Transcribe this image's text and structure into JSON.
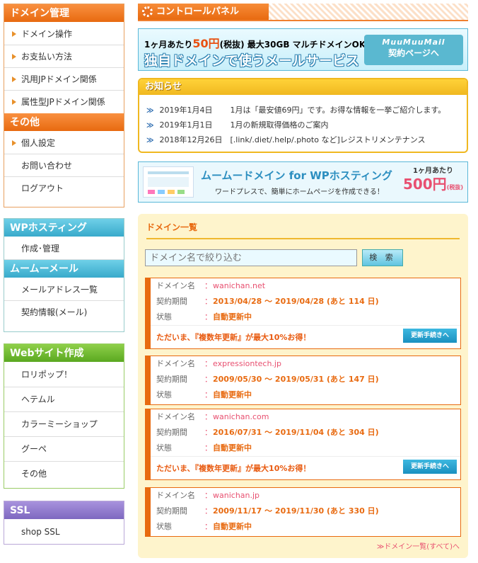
{
  "sidebar": {
    "domain": {
      "title": "ドメイン管理",
      "items": [
        "ドメイン操作",
        "お支払い方法",
        "汎用JPドメイン関係",
        "属性型JPドメイン関係"
      ]
    },
    "other": {
      "title": "その他",
      "items": [
        "個人設定",
        "お問い合わせ",
        "ログアウト"
      ]
    },
    "wp": {
      "title": "WPホスティング",
      "items": [
        "作成･管理"
      ]
    },
    "mail": {
      "title": "ムームーメール",
      "items": [
        "メールアドレス一覧",
        "契約情報(メール)"
      ]
    },
    "web": {
      "title": "Webサイト作成",
      "items": [
        "ロリポップ！",
        "ヘテムル",
        "カラーミーショップ",
        "グーペ",
        "その他"
      ]
    },
    "ssl": {
      "title": "SSL",
      "items": [
        "shop SSL"
      ]
    }
  },
  "control_panel": {
    "title": "コントロールパネル"
  },
  "banner_mail": {
    "line1_a": "1ヶ月あたり",
    "line1_price": "50円",
    "line1_b": "(税抜) 最大30GB マルチドメインOK!",
    "line2": "独自ドメインで使うメールサービス",
    "btn_logo": "MuuMuuMail",
    "btn_text": "契約ページへ"
  },
  "notices": {
    "title": "お知らせ",
    "items": [
      {
        "date": "2019年1月4日",
        "text": "1月は「最安値69円」です。お得な情報を一挙ご紹介します。"
      },
      {
        "date": "2019年1月1日",
        "text": "1月の新規取得価格のご案内"
      },
      {
        "date": "2018年12月26日",
        "text": "[.link/.diet/.help/.photo など]レジストリメンテナンス"
      }
    ]
  },
  "banner_wp": {
    "title": "ムームードメイン for WPホスティング",
    "sub": "ワードプレスで、簡単にホームページを作成できる！",
    "per": "1ヶ月あたり",
    "price": "500円",
    "tax": "(税抜)"
  },
  "domains": {
    "title": "ドメイン一覧",
    "search_placeholder": "ドメイン名で絞り込む",
    "search_btn": "検 索",
    "labels": {
      "name": "ドメイン名",
      "period": "契約期間",
      "status": "状態",
      "colon": "："
    },
    "promo_text": "ただいま、『複数年更新』が最大10%お得！",
    "promo_btn": "更新手続きへ",
    "list": [
      {
        "name": "wanichan.net",
        "period": "2013/04/28 〜 2019/04/28 (あと 114 日)",
        "status": "自動更新中"
      },
      {
        "name": "expressiontech.jp",
        "period": "2009/05/30 〜 2019/05/31 (あと 147 日)",
        "status": "自動更新中"
      },
      {
        "name": "wanichan.com",
        "period": "2016/07/31 〜 2019/11/04 (あと 304 日)",
        "status": "自動更新中"
      },
      {
        "name": "wanichan.jp",
        "period": "2009/11/17 〜 2019/11/30 (あと 330 日)",
        "status": "自動更新中"
      }
    ],
    "all_link": "≫ドメイン一覧(すべて)へ"
  }
}
